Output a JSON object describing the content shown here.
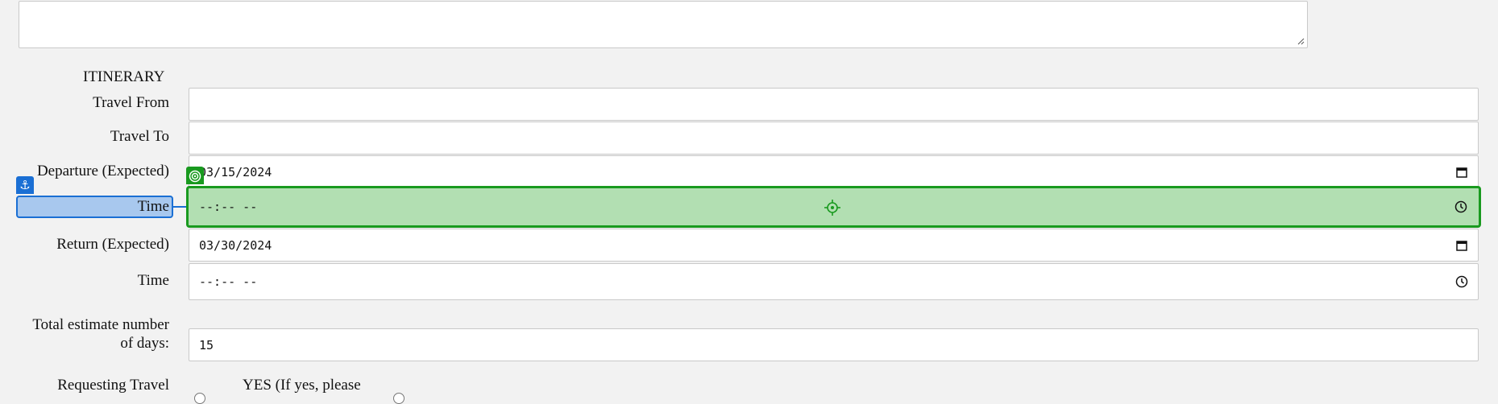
{
  "itinerary": {
    "heading": "ITINERARY",
    "travel_from": {
      "label": "Travel From",
      "value": ""
    },
    "travel_to": {
      "label": "Travel To",
      "value": ""
    },
    "departure": {
      "label": "Departure (Expected)",
      "value": "03/15/2024"
    },
    "departure_time": {
      "label": "Time",
      "value": "--:-- --"
    },
    "return": {
      "label": "Return (Expected)",
      "value": "03/30/2024"
    },
    "return_time": {
      "label": "Time",
      "value": "--:-- --"
    },
    "total_days": {
      "label_line1": "Total estimate number",
      "label_line2": "of days:",
      "value": "15"
    },
    "requesting_travel": {
      "label": "Requesting Travel",
      "yes_option": "YES (If yes, please"
    }
  },
  "annotation": {
    "anchor_symbol": "⚓",
    "target_color": "#199a1f",
    "anchor_color": "#1a6fd4"
  }
}
